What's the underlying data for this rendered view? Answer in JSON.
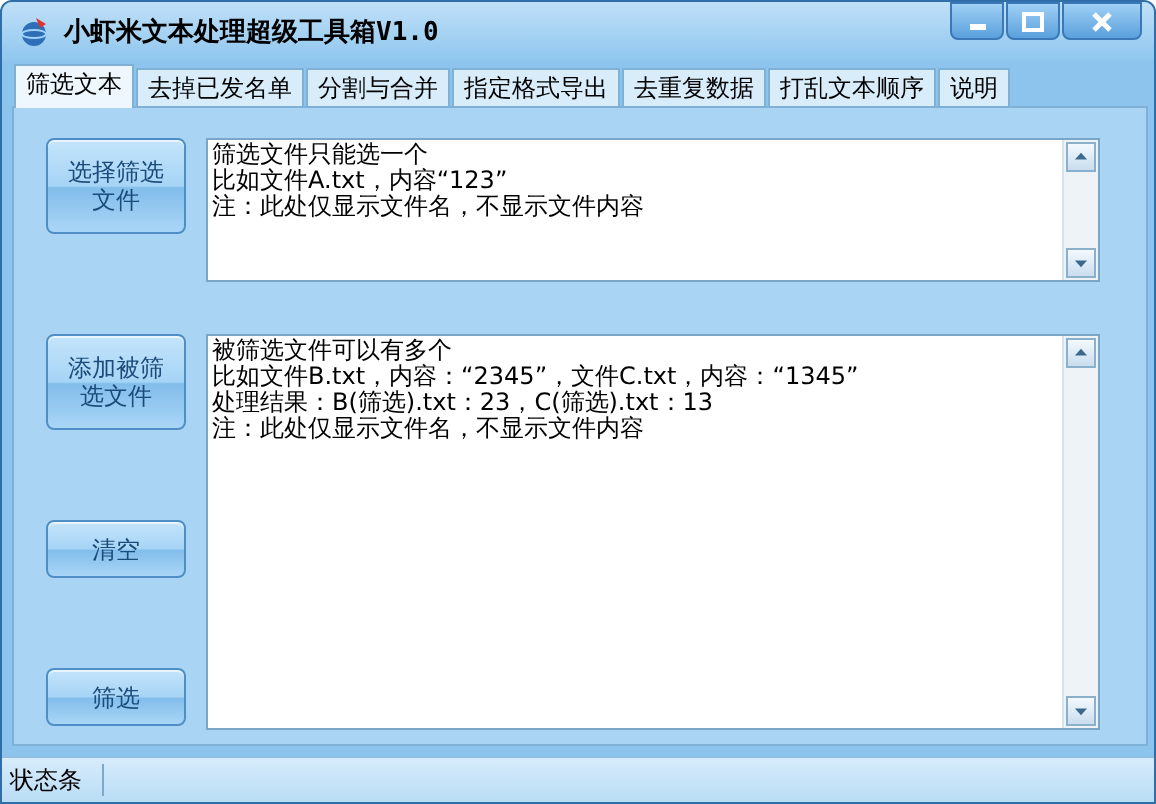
{
  "window": {
    "title": "小虾米文本处理超级工具箱V1.0"
  },
  "tabs": [
    {
      "label": "筛选文本",
      "selected": true
    },
    {
      "label": "去掉已发名单",
      "selected": false
    },
    {
      "label": "分割与合并",
      "selected": false
    },
    {
      "label": "指定格式导出",
      "selected": false
    },
    {
      "label": "去重复数据",
      "selected": false
    },
    {
      "label": "打乱文本顺序",
      "selected": false
    },
    {
      "label": "说明",
      "selected": false
    }
  ],
  "panels": [
    {
      "button": "选择筛选文件",
      "lines": [
        "筛选文件只能选一个",
        "比如文件A.txt，内容“123”",
        "注：此处仅显示文件名，不显示文件内容"
      ]
    },
    {
      "button": "添加被筛选文件",
      "lines": [
        "被筛选文件可以有多个",
        "比如文件B.txt，内容：“2345”，文件C.txt，内容：“1345”",
        "处理结果：B(筛选).txt：23，C(筛选).txt：13",
        "注：此处仅显示文件名，不显示文件内容"
      ]
    }
  ],
  "actions": [
    "清空",
    "筛选"
  ],
  "status_bar": "状态条"
}
